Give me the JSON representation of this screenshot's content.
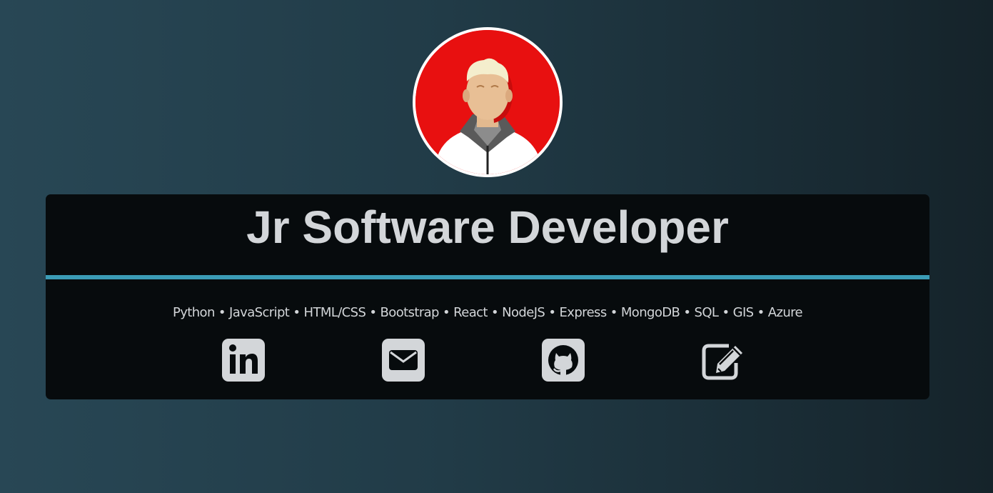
{
  "profile": {
    "avatar_icon": "developer-avatar",
    "title": "Jr Software Developer",
    "skills": "Python • JavaScript • HTML/CSS • Bootstrap • React • NodeJS • Express • MongoDB • SQL • GIS • Azure"
  },
  "social_links": [
    {
      "icon": "linkedin-icon"
    },
    {
      "icon": "envelope-icon"
    },
    {
      "icon": "github-icon"
    },
    {
      "icon": "edit-icon"
    }
  ],
  "colors": {
    "accent": "#3b9cb6",
    "card_background": "#070b0d",
    "text": "#d3d6d9",
    "avatar_background": "#e81010"
  }
}
